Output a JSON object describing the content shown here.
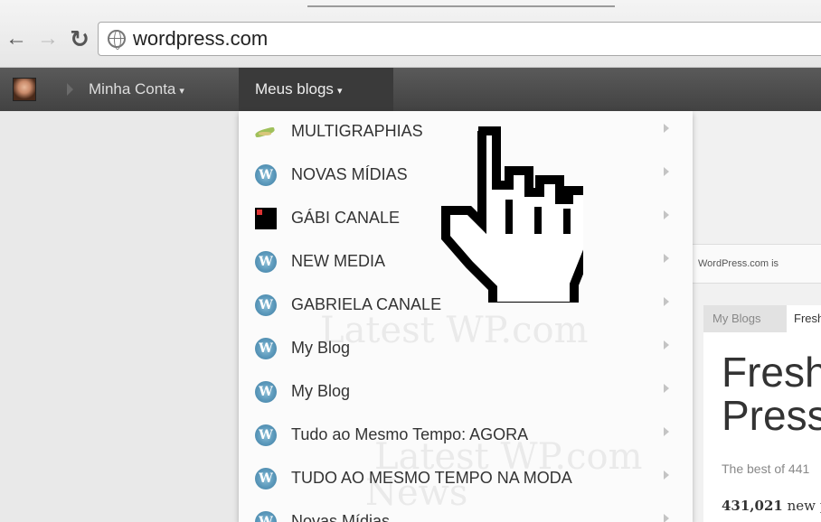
{
  "browser": {
    "url": "wordpress.com",
    "back_icon": "back-arrow-icon",
    "forward_icon": "forward-arrow-icon",
    "reload_icon": "reload-icon",
    "site_icon": "globe-icon"
  },
  "adminbar": {
    "my_account_label": "Minha Conta",
    "my_blogs_label": "Meus blogs",
    "caret": "▾"
  },
  "dropdown": {
    "items": [
      {
        "label": "MULTIGRAPHIAS",
        "icon": "multigraphias-icon"
      },
      {
        "label": "NOVAS MÍDIAS",
        "icon": "wordpress-icon"
      },
      {
        "label": "GÁBI CANALE",
        "icon": "blog-avatar-icon"
      },
      {
        "label": "NEW MEDIA",
        "icon": "wordpress-icon"
      },
      {
        "label": "GABRIELA CANALE",
        "icon": "wordpress-icon"
      },
      {
        "label": "My Blog",
        "icon": "wordpress-icon"
      },
      {
        "label": "My Blog",
        "icon": "wordpress-icon"
      },
      {
        "label": "Tudo ao Mesmo Tempo: AGORA",
        "icon": "wordpress-icon"
      },
      {
        "label": "TUDO AO MESMO TEMPO NA MODA",
        "icon": "wordpress-icon"
      },
      {
        "label": "Novas Mídias",
        "icon": "wordpress-icon"
      }
    ]
  },
  "page": {
    "notice_text": "WordPress.com is",
    "tab_my_blogs": "My Blogs",
    "tab_fresh": "Fresh",
    "fresh_title": "Freshly\nPressed",
    "fresh_sub": "The best of 441",
    "fresh_count_num": "431,021",
    "fresh_count_rest": " new posts",
    "ghost_1": "Latest WP.com",
    "ghost_2": "Latest WP.com",
    "ghost_3": "News"
  },
  "colors": {
    "adminbar": "#464646",
    "dropdown_bg": "#fbfbfb",
    "wp_icon": "#5e9bbd"
  }
}
